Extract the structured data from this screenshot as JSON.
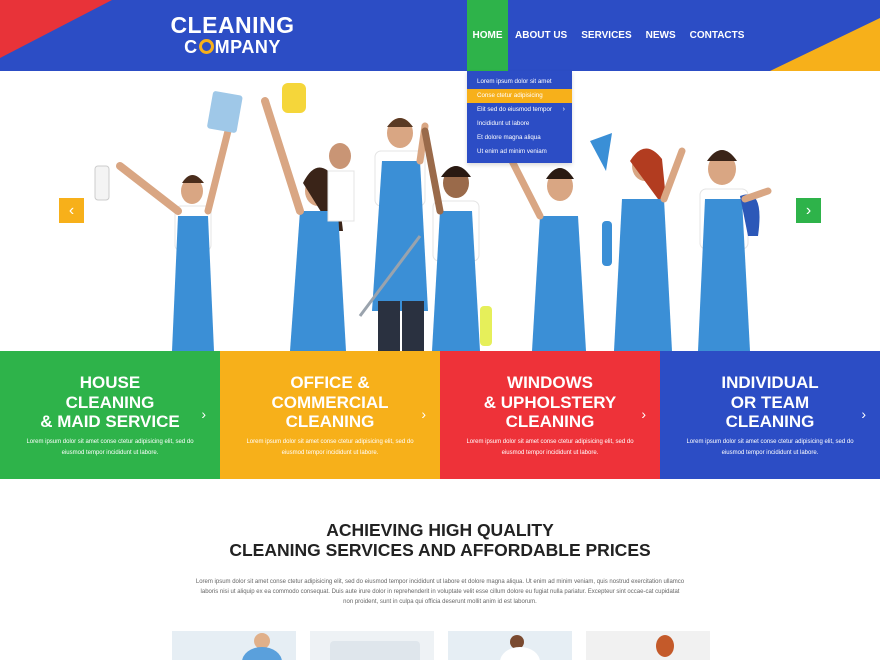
{
  "logo": {
    "line1": "CLEANING",
    "line2_pre": "C",
    "line2_post": "MPANY"
  },
  "nav": {
    "items": [
      {
        "label": "HOME",
        "active": true
      },
      {
        "label": "ABOUT US"
      },
      {
        "label": "SERVICES"
      },
      {
        "label": "NEWS"
      },
      {
        "label": "CONTACTS"
      }
    ],
    "dropdown": [
      {
        "label": "Lorem ipsum dolor sit amet"
      },
      {
        "label": "Conse ctetur adipisicing",
        "active": true
      },
      {
        "label": "Elit sed do eiusmod tempor",
        "has_submenu": true
      },
      {
        "label": "Incididunt ut labore"
      },
      {
        "label": "Et dolore magna aliqua"
      },
      {
        "label": "Ut enim ad minim veniam"
      }
    ]
  },
  "slider": {
    "prev": "‹",
    "next": "›"
  },
  "tiles": [
    {
      "title_lines": [
        "HOUSE",
        "CLEANING",
        "& MAID SERVICE"
      ],
      "text": "Lorem ipsum dolor sit amet conse ctetur adipisicing elit, sed do eiusmod tempor incididunt ut labore.",
      "color": "#2eb34a"
    },
    {
      "title_lines": [
        "OFFICE &",
        "COMMERCIAL",
        "CLEANING"
      ],
      "text": "Lorem ipsum dolor sit amet conse ctetur adipisicing elit, sed do eiusmod tempor incididunt ut labore.",
      "color": "#f7b01a"
    },
    {
      "title_lines": [
        "WINDOWS",
        "& UPHOLSTERY",
        "CLEANING"
      ],
      "text": "Lorem ipsum dolor sit amet conse ctetur adipisicing elit, sed do eiusmod tempor incididunt ut labore.",
      "color": "#ee3239"
    },
    {
      "title_lines": [
        "INDIVIDUAL",
        "OR TEAM",
        "CLEANING"
      ],
      "text": "Lorem ipsum dolor sit amet conse ctetur adipisicing elit, sed do eiusmod tempor incididunt ut labore.",
      "color": "#2c4dc5"
    }
  ],
  "tile_arrow": "›",
  "headline": {
    "line1": "ACHIEVING HIGH QUALITY",
    "line2": "CLEANING SERVICES AND AFFORDABLE PRICES"
  },
  "body_text": "Lorem ipsum dolor sit amet conse ctetur adipisicing elit, sed do eiusmod tempor incididunt ut labore et dolore magna aliqua. Ut enim ad minim veniam, quis nostrud exercitation ullamco laboris nisi ut aliquip ex ea commodo consequat. Duis aute irure dolor in reprehenderit in voluptate velit esse cillum dolore eu fugiat nulla pariatur. Excepteur sint occae-cat cupidatat non proident, sunt in culpa qui officia deserunt mollit anim id est laborum.",
  "colors": {
    "blue": "#2c4dc5",
    "green": "#2eb34a",
    "yellow": "#f7b01a",
    "red": "#ee3239"
  }
}
